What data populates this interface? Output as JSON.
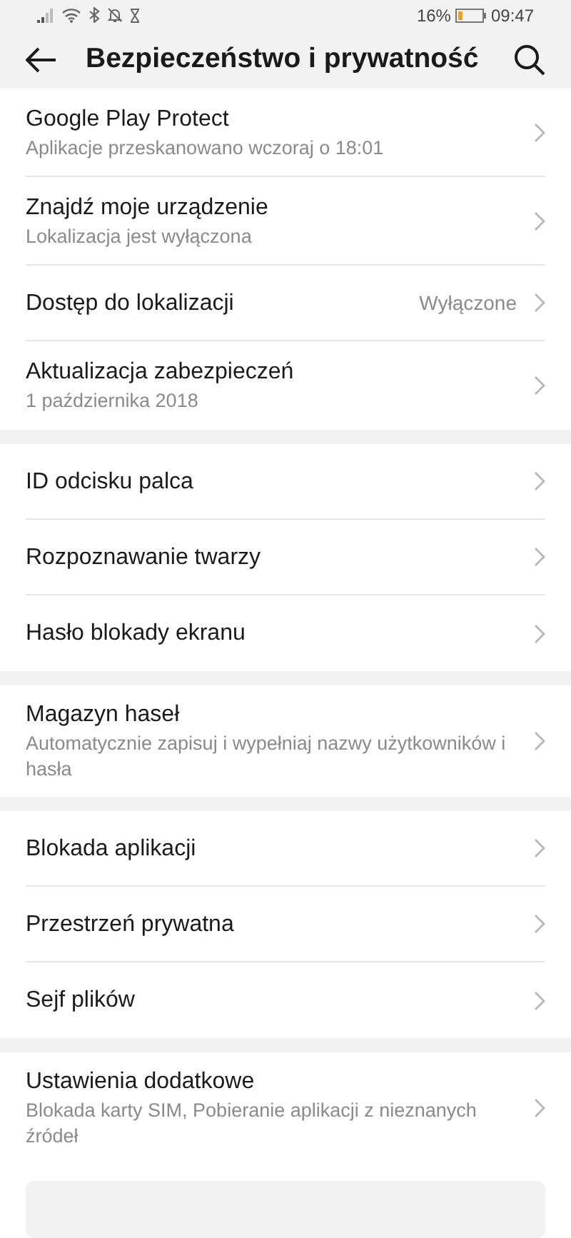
{
  "status_bar": {
    "battery": "16%",
    "time": "09:47"
  },
  "header": {
    "title": "Bezpieczeństwo i prywatność"
  },
  "groups": [
    {
      "items": [
        {
          "title": "Google Play Protect",
          "subtitle": "Aplikacje przeskanowano wczoraj o 18:01"
        },
        {
          "title": "Znajdź moje urządzenie",
          "subtitle": "Lokalizacja jest wyłączona"
        },
        {
          "title": "Dostęp do lokalizacji",
          "value": "Wyłączone"
        },
        {
          "title": "Aktualizacja zabezpieczeń",
          "subtitle": "1 października 2018"
        }
      ]
    },
    {
      "items": [
        {
          "title": "ID odcisku palca"
        },
        {
          "title": "Rozpoznawanie twarzy"
        },
        {
          "title": "Hasło blokady ekranu"
        }
      ]
    },
    {
      "items": [
        {
          "title": "Magazyn haseł",
          "subtitle": "Automatycznie zapisuj i wypełniaj nazwy użytkowników i hasła"
        }
      ]
    },
    {
      "items": [
        {
          "title": "Blokada aplikacji"
        },
        {
          "title": "Przestrzeń prywatna"
        },
        {
          "title": "Sejf plików"
        }
      ]
    },
    {
      "items": [
        {
          "title": "Ustawienia dodatkowe",
          "subtitle": "Blokada karty SIM, Pobieranie aplikacji z nieznanych źródeł"
        }
      ]
    }
  ]
}
